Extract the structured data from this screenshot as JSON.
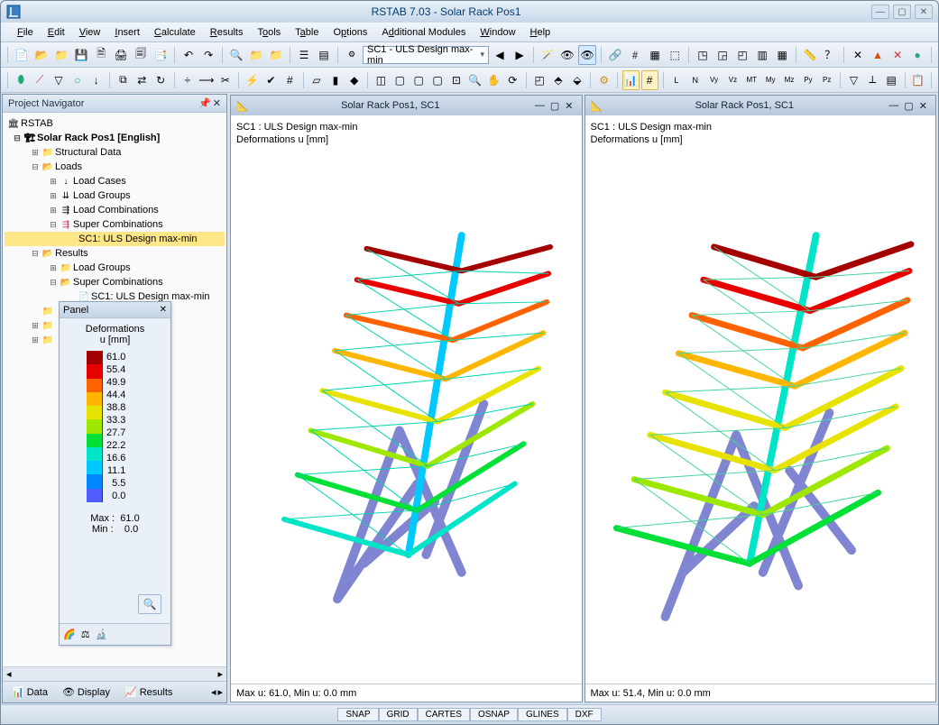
{
  "app": {
    "title": "RSTAB 7.03 - Solar Rack Pos1"
  },
  "menu": [
    "File",
    "Edit",
    "View",
    "Insert",
    "Calculate",
    "Results",
    "Tools",
    "Table",
    "Options",
    "Additional Modules",
    "Window",
    "Help"
  ],
  "toolbar_combo": "SC1 - ULS Design max-min",
  "navigator": {
    "title": "Project Navigator",
    "root": "RSTAB",
    "project": "Solar Rack Pos1 [English]",
    "nodes": {
      "structural": "Structural Data",
      "loads": "Loads",
      "load_cases": "Load Cases",
      "load_groups": "Load Groups",
      "load_combos": "Load Combinations",
      "super_combos": "Super Combinations",
      "sc1": "SC1: ULS Design max-min",
      "results": "Results",
      "r_load_groups": "Load Groups",
      "r_super_combos": "Super Combinations",
      "r_sc1": "SC1: ULS Design max-min"
    },
    "tabs": {
      "data": "Data",
      "display": "Display",
      "results": "Results"
    }
  },
  "panel": {
    "title": "Panel",
    "heading": "Deformations",
    "unit": "u [mm]",
    "scale": [
      {
        "v": "61.0",
        "c": "#a50000"
      },
      {
        "v": "55.4",
        "c": "#e80000"
      },
      {
        "v": "49.9",
        "c": "#ff6200"
      },
      {
        "v": "44.4",
        "c": "#ffb600"
      },
      {
        "v": "38.8",
        "c": "#e8e200"
      },
      {
        "v": "33.3",
        "c": "#9ee800"
      },
      {
        "v": "27.7",
        "c": "#00e036"
      },
      {
        "v": "22.2",
        "c": "#00e5c7"
      },
      {
        "v": "16.6",
        "c": "#00c9ff"
      },
      {
        "v": "11.1",
        "c": "#0086ff"
      },
      {
        "v": "5.5",
        "c": "#4f5cff"
      },
      {
        "v": "0.0",
        "c": "#7f85d0"
      }
    ],
    "max_label": "Max :",
    "max_value": "61.0",
    "min_label": "Min :",
    "min_value": "0.0"
  },
  "views": {
    "left": {
      "title": "Solar Rack Pos1, SC1",
      "line1": "SC1 : ULS Design max-min",
      "line2": "Deformations u [mm]",
      "status": "Max u: 61.0, Min u: 0.0 mm"
    },
    "right": {
      "title": "Solar Rack Pos1, SC1",
      "line1": "SC1 : ULS Design max-min",
      "line2": "Deformations u [mm]",
      "status": "Max u: 51.4, Min u: 0.0 mm"
    }
  },
  "statusbar": [
    "SNAP",
    "GRID",
    "CARTES",
    "OSNAP",
    "GLINES",
    "DXF"
  ],
  "chart_data": {
    "type": "heatmap",
    "title": "Deformations u [mm]",
    "colorscale_values": [
      0.0,
      5.5,
      11.1,
      16.6,
      22.2,
      27.7,
      33.3,
      38.8,
      44.4,
      49.9,
      55.4,
      61.0
    ],
    "colorscale_colors": [
      "#7f85d0",
      "#4f5cff",
      "#0086ff",
      "#00c9ff",
      "#00e5c7",
      "#00e036",
      "#9ee800",
      "#e8e200",
      "#ffb600",
      "#ff6200",
      "#e80000",
      "#a50000"
    ],
    "view_left": {
      "max_u": 61.0,
      "min_u": 0.0
    },
    "view_right": {
      "max_u": 51.4,
      "min_u": 0.0
    }
  }
}
